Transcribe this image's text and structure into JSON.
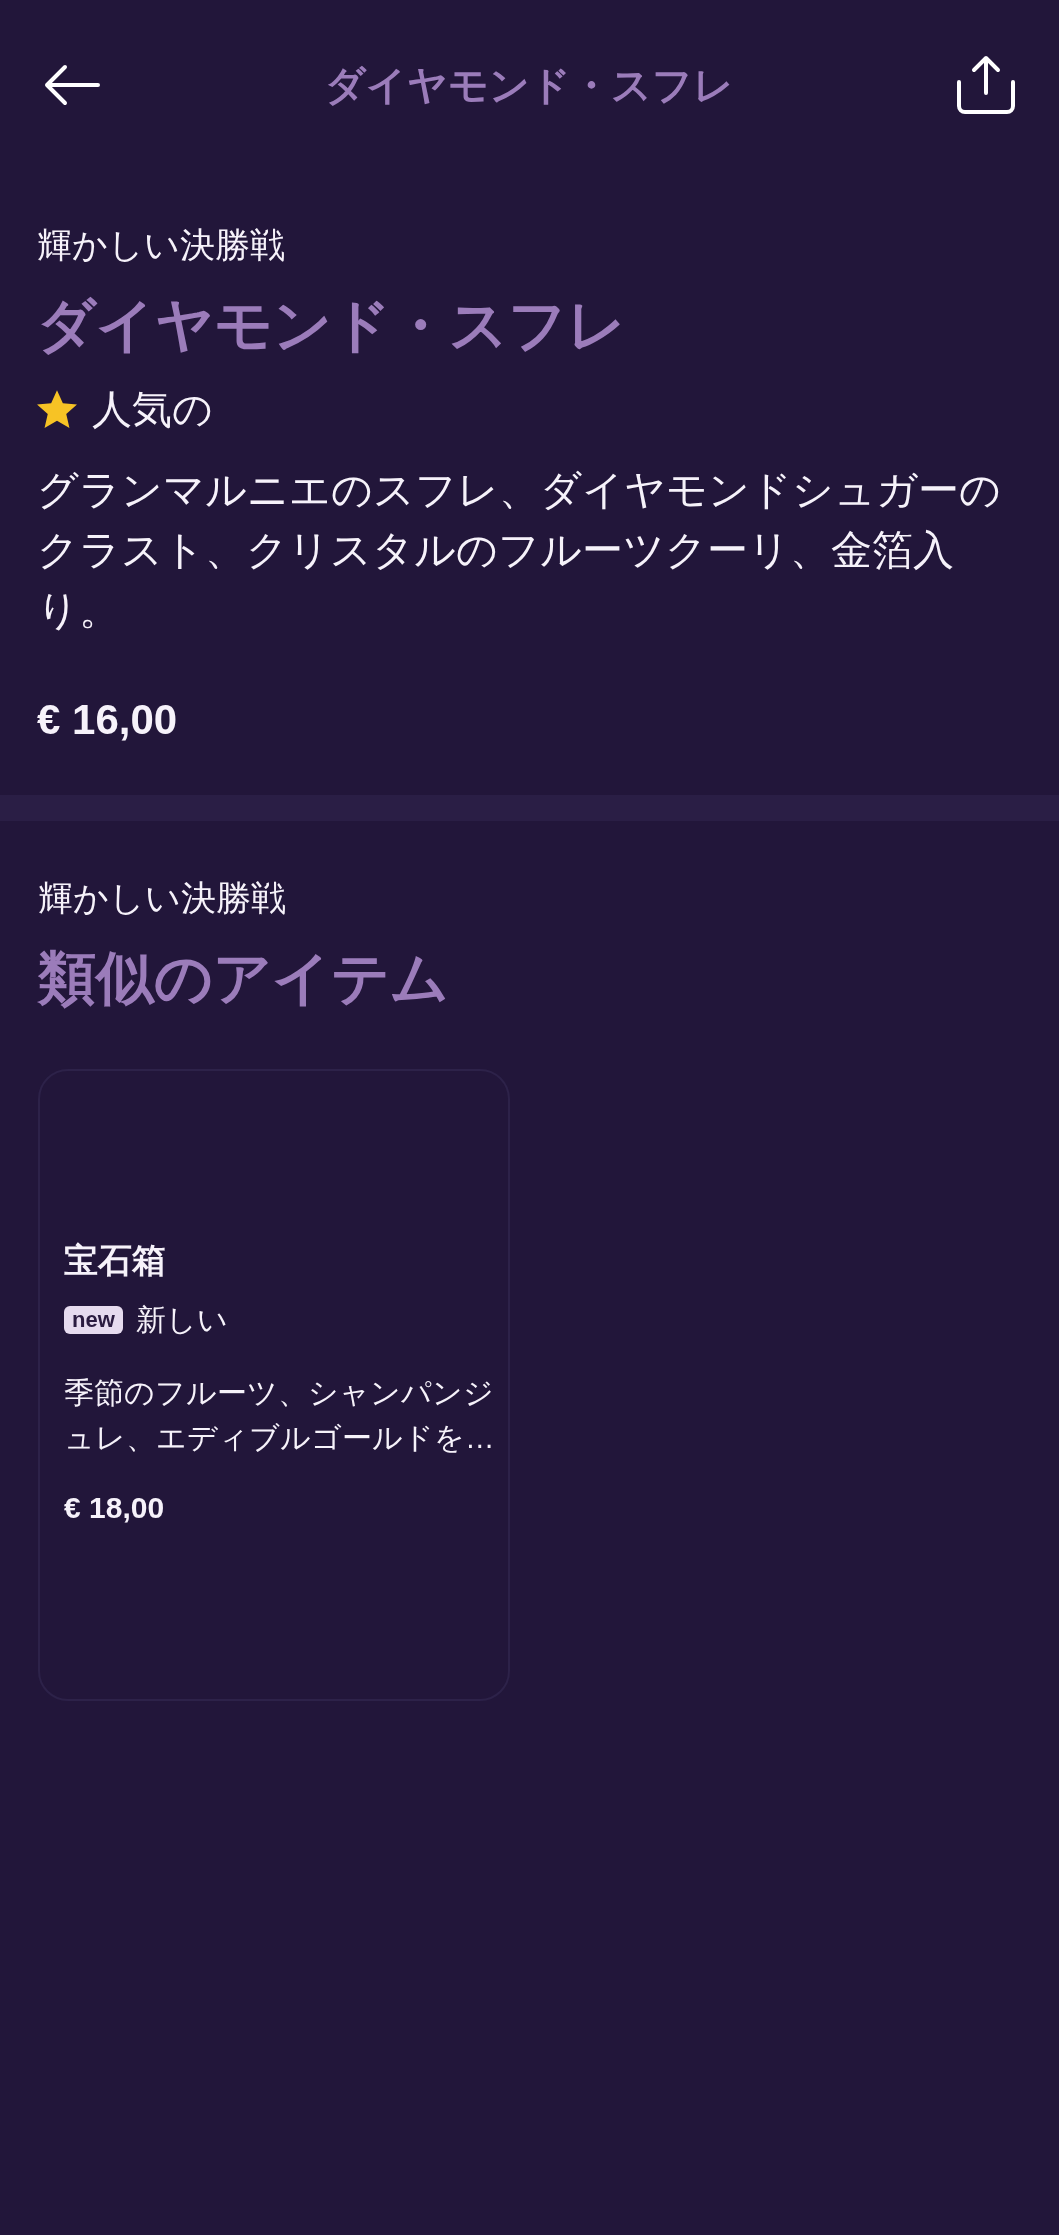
{
  "header": {
    "title": "ダイヤモンド・スフレ"
  },
  "item": {
    "category": "輝かしい決勝戦",
    "name": "ダイヤモンド・スフレ",
    "tag": {
      "kind": "popular",
      "label": "人気の"
    },
    "description": "グランマルニエのスフレ、ダイヤモンドシュガーのクラスト、クリスタルのフルーツクーリ、金箔入り。",
    "price": "€ 16,00"
  },
  "similar": {
    "category": "輝かしい決勝戦",
    "title": "類似のアイテム",
    "items": [
      {
        "name": "宝石箱",
        "tag": {
          "kind": "new",
          "badge": "new",
          "label": "新しい"
        },
        "description": "季節のフルーツ、シャンパンジュレ、エディブルゴールドを…",
        "price": "€ 18,00"
      }
    ]
  }
}
